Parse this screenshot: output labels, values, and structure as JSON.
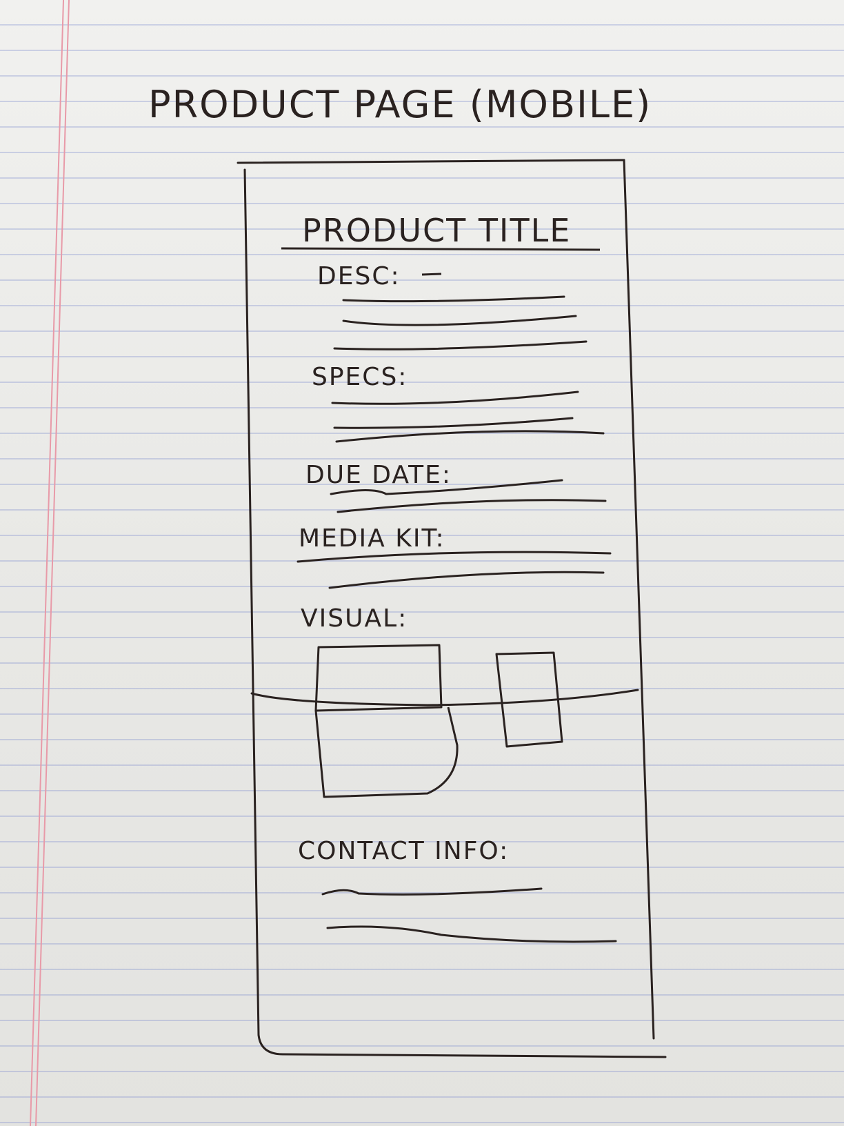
{
  "heading": "PRODUCT PAGE (MOBILE)",
  "wireframe": {
    "product_title": "PRODUCT TITLE",
    "desc_label": "DESC:",
    "specs_label": "SPECS:",
    "due_date_label": "DUE DATE:",
    "media_kit_label": "MEDIA KIT:",
    "visual_label": "VISUAL:",
    "contact_label": "CONTACT INFO:"
  },
  "ink_color": "#2a2220",
  "paper_color": "#ececea",
  "margin_line_color": "#e89aa8",
  "rule_line_color": "#9aa4d8"
}
